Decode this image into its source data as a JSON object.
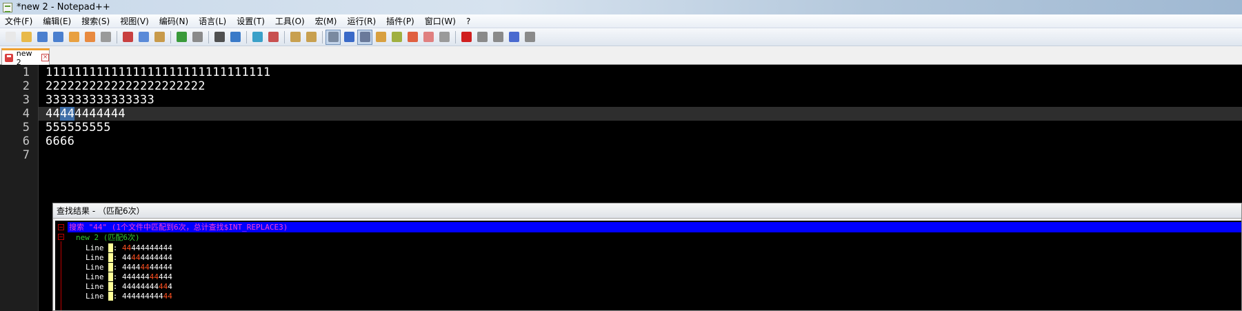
{
  "window": {
    "title": "*new 2 - Notepad++"
  },
  "menu": [
    "文件(F)",
    "编辑(E)",
    "搜索(S)",
    "视图(V)",
    "编码(N)",
    "语言(L)",
    "设置(T)",
    "工具(O)",
    "宏(M)",
    "运行(R)",
    "插件(P)",
    "窗口(W)",
    "?"
  ],
  "toolbar": {
    "buttons": [
      {
        "name": "new-file-icon",
        "color": "#e8e8e8"
      },
      {
        "name": "open-file-icon",
        "color": "#e8b94a"
      },
      {
        "name": "save-icon",
        "color": "#4a7fcf"
      },
      {
        "name": "save-all-icon",
        "color": "#4a7fcf"
      },
      {
        "name": "close-icon",
        "color": "#e8a040"
      },
      {
        "name": "close-all-icon",
        "color": "#e88a40"
      },
      {
        "name": "print-icon",
        "color": "#9a9a9a"
      },
      {
        "sep": true
      },
      {
        "name": "cut-icon",
        "color": "#c84040"
      },
      {
        "name": "copy-icon",
        "color": "#5a8ad8"
      },
      {
        "name": "paste-icon",
        "color": "#c89a4a"
      },
      {
        "sep": true
      },
      {
        "name": "undo-icon",
        "color": "#3a9a3a"
      },
      {
        "name": "redo-icon",
        "color": "#8a8a8a"
      },
      {
        "sep": true
      },
      {
        "name": "find-icon",
        "color": "#505050"
      },
      {
        "name": "replace-icon",
        "color": "#3a7ac8"
      },
      {
        "sep": true
      },
      {
        "name": "zoom-in-icon",
        "color": "#3aa0c8"
      },
      {
        "name": "zoom-out-icon",
        "color": "#c85050"
      },
      {
        "sep": true
      },
      {
        "name": "sync-vertical-icon",
        "color": "#c8a050"
      },
      {
        "name": "sync-horizontal-icon",
        "color": "#c8a050"
      },
      {
        "sep": true
      },
      {
        "name": "word-wrap-icon",
        "color": "#7a8aa0",
        "pressed": true
      },
      {
        "name": "show-all-chars-icon",
        "color": "#3a6ac8"
      },
      {
        "name": "indent-guide-icon",
        "color": "#6a7a9a",
        "pressed": true
      },
      {
        "name": "user-lang-icon",
        "color": "#d8a040"
      },
      {
        "name": "doc-map-icon",
        "color": "#a0b040"
      },
      {
        "name": "function-list-icon",
        "color": "#e06040"
      },
      {
        "name": "folder-workspace-icon",
        "color": "#e08080"
      },
      {
        "name": "monitor-icon",
        "color": "#9a9a9a"
      },
      {
        "sep": true
      },
      {
        "name": "record-macro-icon",
        "color": "#d02020"
      },
      {
        "name": "stop-macro-icon",
        "color": "#8a8a8a"
      },
      {
        "name": "play-macro-icon",
        "color": "#8a8a8a"
      },
      {
        "name": "run-macro-multiple-icon",
        "color": "#4a6ad0"
      },
      {
        "name": "save-macro-icon",
        "color": "#8a8a8a"
      }
    ]
  },
  "tab": {
    "label": "new 2"
  },
  "editor": {
    "line_numbers": [
      "1",
      "2",
      "3",
      "4",
      "5",
      "6",
      "7"
    ],
    "lines": [
      "1111111111111111111111111111111",
      "2222222222222222222222",
      "333333333333333",
      "44444444444",
      "555555555",
      "6666",
      ""
    ],
    "selection": {
      "line": 4,
      "before": "44",
      "selected": "44",
      "after": "4444444"
    }
  },
  "find_results": {
    "header": "查找结果 - （匹配6次）",
    "search_summary": "搜索 \"44\" (1个文件中匹配到6次，总计查找$INT_REPLACE3)",
    "file_entry": "new 2 (匹配6次)",
    "results": [
      {
        "prefix": "Line ",
        "num": "4",
        "sep": ": ",
        "before": "",
        "match": "44",
        "after": "444444444"
      },
      {
        "prefix": "Line ",
        "num": "4",
        "sep": ": ",
        "before": "44",
        "match": "44",
        "after": "4444444"
      },
      {
        "prefix": "Line ",
        "num": "4",
        "sep": ": ",
        "before": "4444",
        "match": "44",
        "after": "44444"
      },
      {
        "prefix": "Line ",
        "num": "4",
        "sep": ": ",
        "before": "444444",
        "match": "44",
        "after": "444"
      },
      {
        "prefix": "Line ",
        "num": "4",
        "sep": ": ",
        "before": "44444444",
        "match": "44",
        "after": "4"
      },
      {
        "prefix": "Line ",
        "num": "4",
        "sep": ": ",
        "before": "444444444",
        "match": "44",
        "after": ""
      }
    ]
  }
}
